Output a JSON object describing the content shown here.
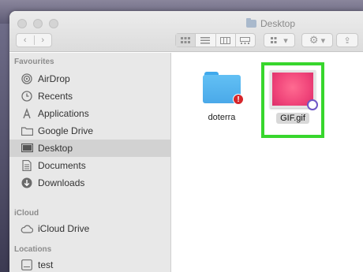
{
  "window": {
    "title": "Desktop"
  },
  "toolbar": {
    "back_label": "‹",
    "forward_label": "›",
    "view_icons": [
      "icon-view-icon",
      "list-view-icon",
      "column-view-icon",
      "gallery-view-icon"
    ],
    "group_label": "▾",
    "action_label": "▾",
    "share_label": "⇪"
  },
  "sidebar": {
    "favourites_header": "Favourites",
    "favourites": [
      {
        "label": "AirDrop",
        "icon": "airdrop-icon"
      },
      {
        "label": "Recents",
        "icon": "clock-icon"
      },
      {
        "label": "Applications",
        "icon": "applications-icon"
      },
      {
        "label": "Google Drive",
        "icon": "folder-icon"
      },
      {
        "label": "Desktop",
        "icon": "desktop-icon"
      },
      {
        "label": "Documents",
        "icon": "document-icon"
      },
      {
        "label": "Downloads",
        "icon": "download-icon"
      }
    ],
    "icloud_header": "iCloud",
    "icloud": [
      {
        "label": "iCloud Drive",
        "icon": "cloud-icon"
      }
    ],
    "locations_header": "Locations",
    "locations": [
      {
        "label": "test",
        "icon": "disk-icon"
      }
    ]
  },
  "content": {
    "files": [
      {
        "name": "doterra",
        "icon": "folder-icon",
        "badge": "!"
      },
      {
        "name": "GIF.gif",
        "icon": "gif-file-icon"
      }
    ]
  },
  "colors": {
    "highlight": "#38d62d",
    "folder_blue": "#4aa9e9",
    "gif_pink": "#f0457a"
  }
}
